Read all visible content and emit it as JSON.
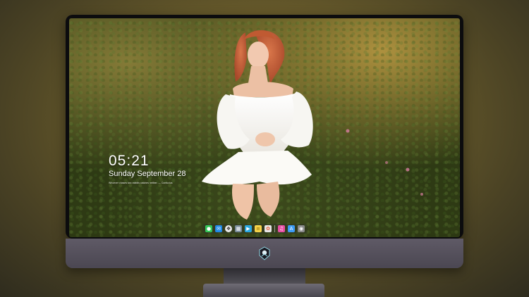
{
  "lockscreen": {
    "time": "05:21",
    "date": "Sunday September  28",
    "quote": "Whoever chases two rabbits catches neither. — Confucius"
  },
  "dock": {
    "apps": [
      {
        "icon": "messages-icon",
        "color": "#34c759"
      },
      {
        "icon": "mail-icon",
        "color": "#1e88e5"
      },
      {
        "icon": "safari-icon",
        "color": "#e8e8e8"
      },
      {
        "icon": "finder-icon",
        "color": "#7a8c9a"
      },
      {
        "icon": "claquette-icon",
        "color": "#2aa7e0"
      },
      {
        "icon": "notes-icon",
        "color": "#f5d34a"
      },
      {
        "icon": "photos-icon",
        "color": "#e6e6e6"
      },
      {
        "icon": "music-icon",
        "color": "#e84fa4"
      },
      {
        "icon": "app-store-icon",
        "color": "#3b9bf5"
      },
      {
        "icon": "camera-icon",
        "color": "#8a8a8a"
      }
    ]
  },
  "colors": {
    "backdrop": "#6d5f2c",
    "bezel": "#0c0c0e",
    "chin": "#55515c"
  }
}
